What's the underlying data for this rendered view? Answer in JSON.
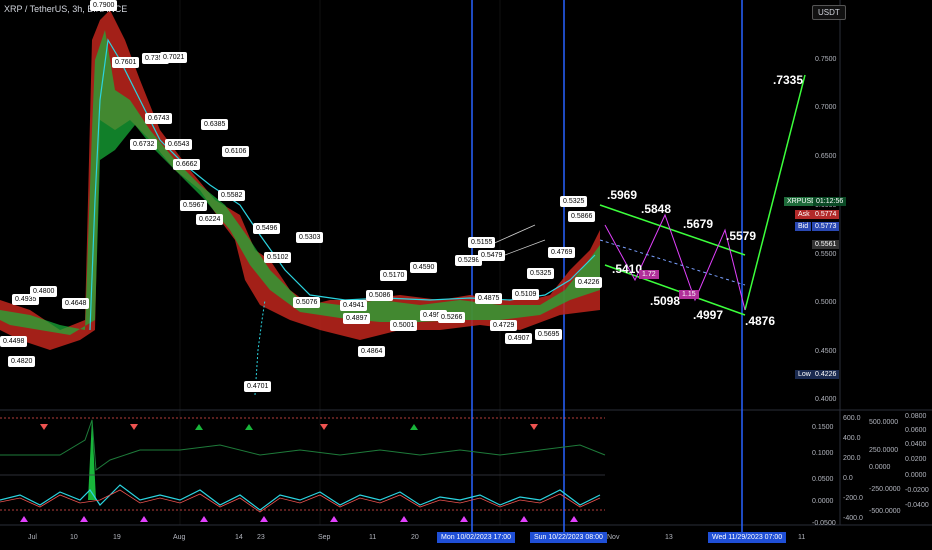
{
  "header": {
    "title": "XRP / TetherUS, 3h, BINANCE"
  },
  "currency_button": "USDT",
  "price_axis": [
    "0.7500",
    "0.7000",
    "0.6500",
    "0.6000",
    "0.5500",
    "0.5000",
    "0.4500",
    "0.4000"
  ],
  "osc_axis_1": [
    "0.1500",
    "0.1000",
    "0.0500",
    "0.0000",
    "-0.0500"
  ],
  "osc_axis_2": [
    "600.0",
    "400.0",
    "200.0",
    "0.0",
    "-200.0",
    "-400.0"
  ],
  "osc_axis_3": [
    "500.0000",
    "250.0000",
    "0.0000",
    "-250.0000",
    "-500.0000"
  ],
  "osc_axis_4": [
    "0.0800",
    "0.0600",
    "0.0400",
    "0.0200",
    "0.0000",
    "-0.0200",
    "-0.0400"
  ],
  "ticker": {
    "symbol": "XRPUSDT",
    "countdown": "01:12:56",
    "ask_label": "Ask",
    "ask": "0.5774",
    "bid_label": "Bid",
    "bid": "0.5773",
    "current": "0.5561",
    "low_label": "Low",
    "low": "0.4226"
  },
  "x_ticks": [
    "Jul",
    "10",
    "19",
    "Aug",
    "14",
    "23",
    "Sep",
    "11",
    "20",
    "Nov",
    "13",
    "11"
  ],
  "date_boxes": [
    "Mon 10/02/2023  17:00",
    "Sun 10/22/2023  08:00",
    "Wed 11/29/2023  07:00"
  ],
  "forecast_labels": [
    ".5969",
    ".5848",
    ".5679",
    ".5579",
    ".5410",
    ".5098",
    ".4997",
    ".4876",
    ".7335"
  ],
  "forecast_tags": [
    "1.72",
    "1.15"
  ],
  "price_labels": [
    "0.7900",
    "0.7601",
    "0.7358",
    "0.7021",
    "0.6743",
    "0.6732",
    "0.6543",
    "0.6662",
    "0.6385",
    "0.6106",
    "0.5967",
    "0.6224",
    "0.5582",
    "0.5496",
    "0.5303",
    "0.5102",
    "0.5076",
    "0.4941",
    "0.4897",
    "0.5086",
    "0.5170",
    "0.4590",
    "0.4864",
    "0.5001",
    "0.4952",
    "0.5266",
    "0.5298",
    "0.5479",
    "0.5155",
    "0.4875",
    "0.4729",
    "0.4907",
    "0.5109",
    "0.5325",
    "0.4769",
    "0.5695",
    "0.5866",
    "0.5325",
    "0.4226",
    "0.4701",
    "0.4498",
    "0.4820",
    "0.4935",
    "0.4800",
    "0.4648"
  ],
  "markers": [
    "Bullish",
    "Bearish",
    "Bullish"
  ],
  "colors": {
    "up": "#26a69a",
    "down": "#ef5350",
    "accent": "#2962ff",
    "forecast": "#3cff3c",
    "pattern": "#e040fb"
  }
}
